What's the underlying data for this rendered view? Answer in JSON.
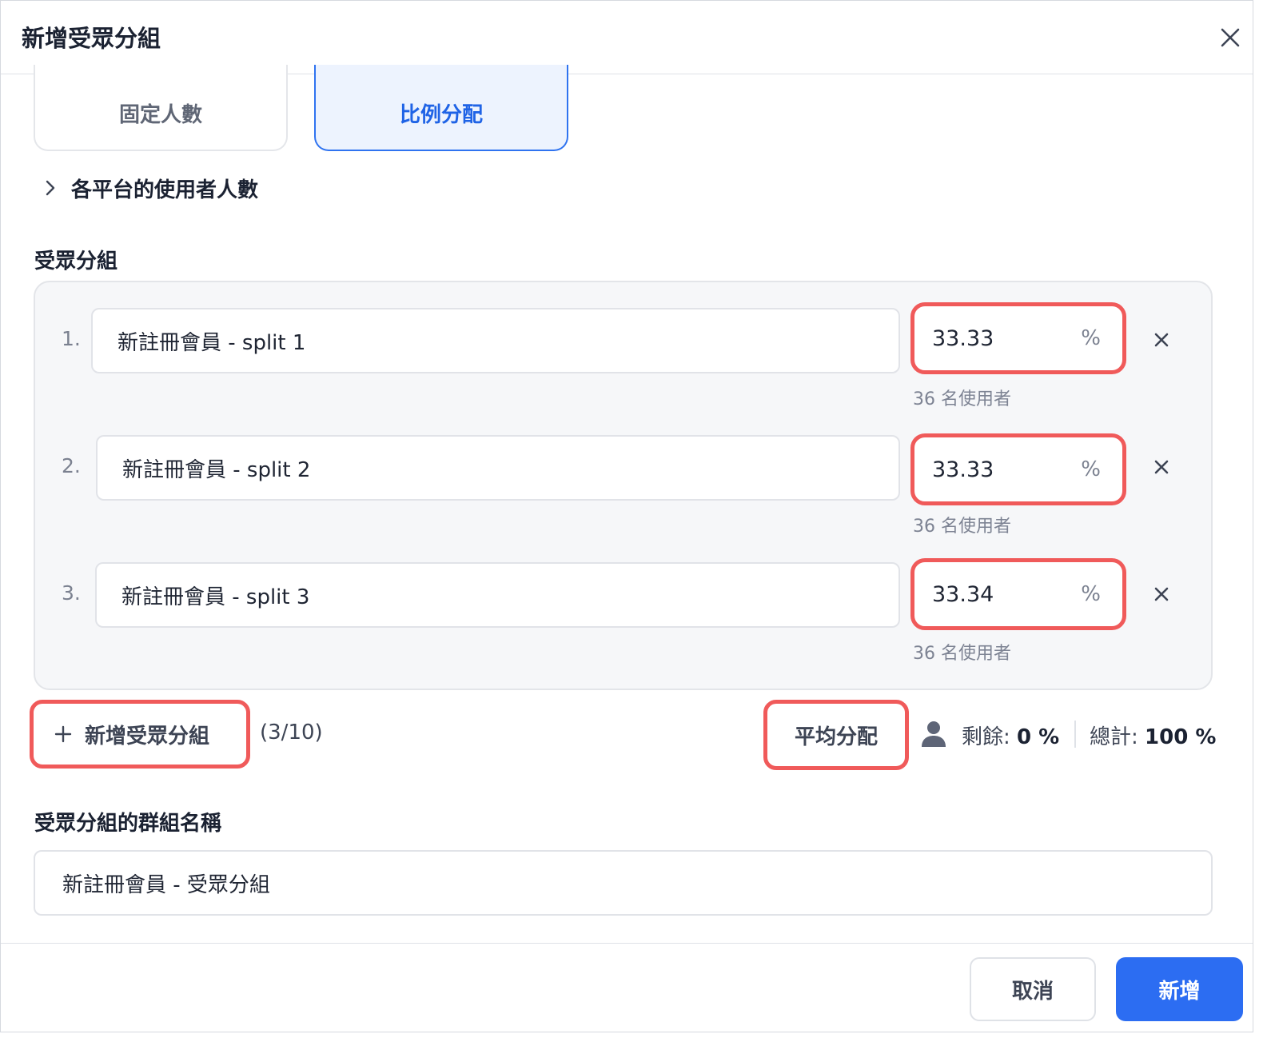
{
  "dialog": {
    "title": "新增受眾分組"
  },
  "modes": {
    "fixed_label": "固定人數",
    "ratio_label": "比例分配",
    "active": "比例分配"
  },
  "platform_users": {
    "label": "各平台的使用者人數"
  },
  "groups_section": {
    "label": "受眾分組",
    "rows": [
      {
        "index": "1.",
        "name": "新註冊會員 - split 1",
        "percent": "33.33",
        "unit": "%",
        "users": "36 名使用者"
      },
      {
        "index": "2.",
        "name": "新註冊會員 - split 2",
        "percent": "33.33",
        "unit": "%",
        "users": "36 名使用者"
      },
      {
        "index": "3.",
        "name": "新註冊會員 - split 3",
        "percent": "33.34",
        "unit": "%",
        "users": "36 名使用者"
      }
    ]
  },
  "controls": {
    "add_group_label": "新增受眾分組",
    "count": "(3/10)",
    "even_split_label": "平均分配",
    "remaining_label": "剩餘:",
    "remaining_value": "0 %",
    "total_label": "總計:",
    "total_value": "100 %"
  },
  "group_name": {
    "label": "受眾分組的群組名稱",
    "value": "新註冊會員 - 受眾分組"
  },
  "footer": {
    "cancel_label": "取消",
    "submit_label": "新增"
  },
  "colors": {
    "accent": "#2c6df2",
    "highlight": "#f05a5a",
    "panel_bg": "#f6f7f9"
  },
  "icons": [
    "close-icon",
    "chevron-right-icon",
    "remove-icon",
    "plus-icon",
    "person-icon"
  ]
}
